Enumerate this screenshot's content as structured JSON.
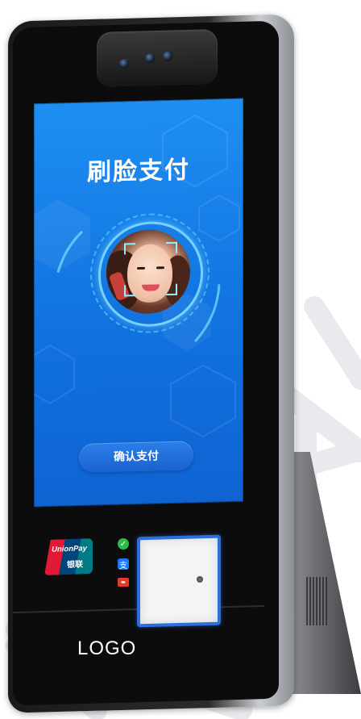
{
  "screen": {
    "title": "刷脸支付",
    "confirm_button_label": "确认支付"
  },
  "payment_logo": {
    "brand_text": "UnionPay",
    "brand_text_cn": "银联"
  },
  "device": {
    "logo_text": "LOGO"
  },
  "colors": {
    "screen_blue": "#1172e0",
    "button_blue": "#1a62cf",
    "scanner_border": "#2a6fe0",
    "unionpay_red": "#e21836",
    "unionpay_blue": "#00447c",
    "unionpay_teal": "#007b84"
  },
  "icons": [
    "camera-lens-icon",
    "check-icon",
    "alipay-icon",
    "card-icon",
    "face-scan-icon"
  ]
}
